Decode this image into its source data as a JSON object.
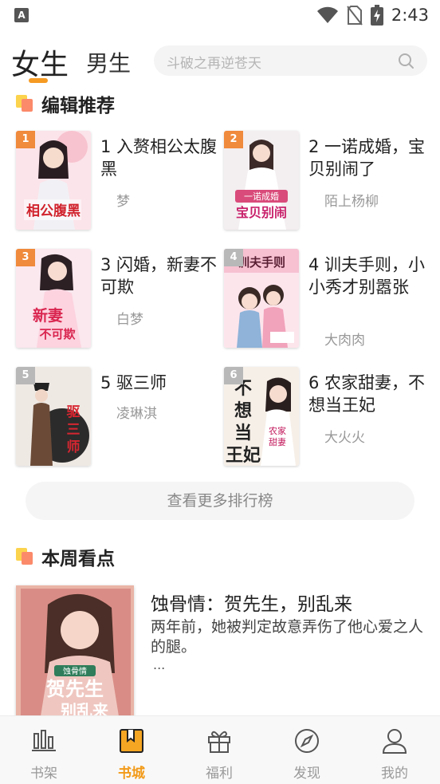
{
  "status_bar": {
    "app_icon": "A",
    "time": "2:43",
    "icons": [
      "wifi-icon",
      "no-sim-icon",
      "battery-charging-icon"
    ]
  },
  "header": {
    "tabs": [
      {
        "label": "女生",
        "active": true
      },
      {
        "label": "男生",
        "active": false
      }
    ],
    "search": {
      "placeholder": "斗破之再逆苍天",
      "icon": "search-icon"
    }
  },
  "editor_picks": {
    "title": "编辑推荐",
    "books": [
      {
        "rank": "1",
        "title": "1 入赘相公太腹黑",
        "author": "梦",
        "badge_color": "#f08a3c"
      },
      {
        "rank": "2",
        "title": "2 一诺成婚，宝贝别闹了",
        "author": "陌上杨柳",
        "badge_color": "#f08a3c"
      },
      {
        "rank": "3",
        "title": "3 闪婚，新妻不可欺",
        "author": "白梦",
        "badge_color": "#f08a3c"
      },
      {
        "rank": "4",
        "title": "4 训夫手则，小小秀才别嚣张",
        "author": "大肉肉",
        "badge_color": "#b8b8b8"
      },
      {
        "rank": "5",
        "title": "5 驱三师",
        "author": "凌琳淇",
        "badge_color": "#b8b8b8"
      },
      {
        "rank": "6",
        "title": "6 农家甜妻，不想当王妃",
        "author": "大火火",
        "badge_color": "#b8b8b8"
      }
    ],
    "more_label": "查看更多排行榜"
  },
  "weekly": {
    "title": "本周看点",
    "book": {
      "title": "蚀骨情：贺先生，别乱来",
      "description": "两年前，她被判定故意弄伤了他心爱之人的腿。",
      "ellipsis": "..."
    }
  },
  "bottom_nav": [
    {
      "label": "书架",
      "icon": "bookshelf-icon",
      "active": false
    },
    {
      "label": "书城",
      "icon": "bookstore-icon",
      "active": true
    },
    {
      "label": "福利",
      "icon": "gift-icon",
      "active": false
    },
    {
      "label": "发现",
      "icon": "compass-icon",
      "active": false
    },
    {
      "label": "我的",
      "icon": "profile-icon",
      "active": false
    }
  ],
  "colors": {
    "accent": "#f29a18",
    "search_bg": "#f4f4f4"
  }
}
